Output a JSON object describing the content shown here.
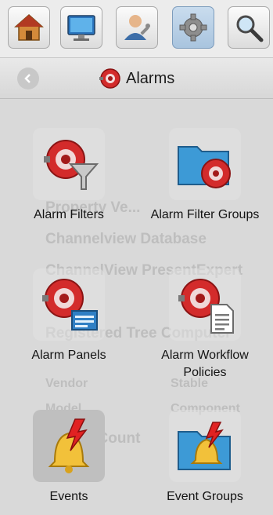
{
  "toolbar": {
    "buttons": [
      {
        "name": "home-icon"
      },
      {
        "name": "monitor-icon"
      },
      {
        "name": "user-wrench-icon"
      },
      {
        "name": "gear-icon",
        "active": true
      },
      {
        "name": "search-icon"
      }
    ]
  },
  "header": {
    "title": "Alarms",
    "back_icon": "chevron-left-icon",
    "title_icon": "alarm-bell-icon"
  },
  "background_ghost_text": [
    "Property Ve...",
    "Channelview Database",
    "ChannelView PresentExpert",
    "Registered Tree Computer",
    "Model",
    "Vendor",
    "Model",
    "Stable",
    "Component",
    "Device Count"
  ],
  "tiles": [
    {
      "label": "Alarm Filters",
      "icon": "alarm-filter-icon"
    },
    {
      "label": "Alarm Filter Groups",
      "icon": "alarm-filter-group-icon"
    },
    {
      "label": "Alarm Panels",
      "icon": "alarm-panel-icon"
    },
    {
      "label": "Alarm Workflow Policies",
      "icon": "alarm-workflow-icon"
    },
    {
      "label": "Events",
      "icon": "events-bell-icon",
      "selected": true
    },
    {
      "label": "Event Groups",
      "icon": "event-group-icon"
    }
  ],
  "colors": {
    "alarm_red": "#d32b2b",
    "folder_blue": "#3d9ad6",
    "bell_gold": "#f2c13a"
  }
}
